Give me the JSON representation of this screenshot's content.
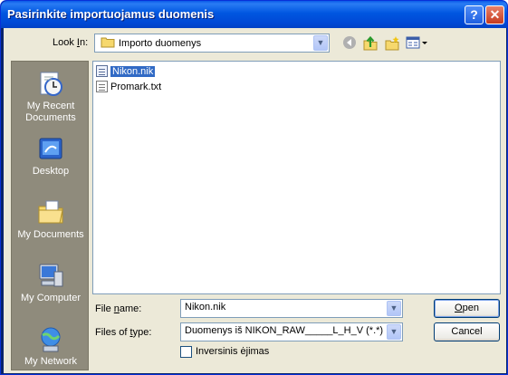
{
  "window": {
    "title": "Pasirinkite importuojamus duomenis",
    "help_glyph": "?",
    "close_glyph": "✕"
  },
  "lookin": {
    "label_u": "I",
    "label_rest": "n:",
    "label_pre": "Look ",
    "value": "Importo duomenys"
  },
  "places": [
    {
      "name": "recent",
      "line1": "My Recent",
      "line2": "Documents"
    },
    {
      "name": "desktop",
      "line1": "Desktop",
      "line2": ""
    },
    {
      "name": "documents",
      "line1": "My Documents",
      "line2": ""
    },
    {
      "name": "computer",
      "line1": "My Computer",
      "line2": ""
    },
    {
      "name": "network",
      "line1": "My Network",
      "line2": ""
    }
  ],
  "files": [
    {
      "name": "Nikon.nik",
      "selected": true
    },
    {
      "name": "Promark.txt",
      "selected": false
    }
  ],
  "filename": {
    "label_pre": "File ",
    "label_u": "n",
    "label_rest": "ame:",
    "value": "Nikon.nik"
  },
  "filetype": {
    "label_pre": "Files of ",
    "label_u": "t",
    "label_rest": "ype:",
    "value": "Duomenys iš NIKON_RAW_____L_H_V  (*.*)"
  },
  "buttons": {
    "open_u": "O",
    "open_rest": "pen",
    "cancel": "Cancel"
  },
  "checkbox": {
    "label": "Inversinis ėjimas",
    "checked": false
  }
}
